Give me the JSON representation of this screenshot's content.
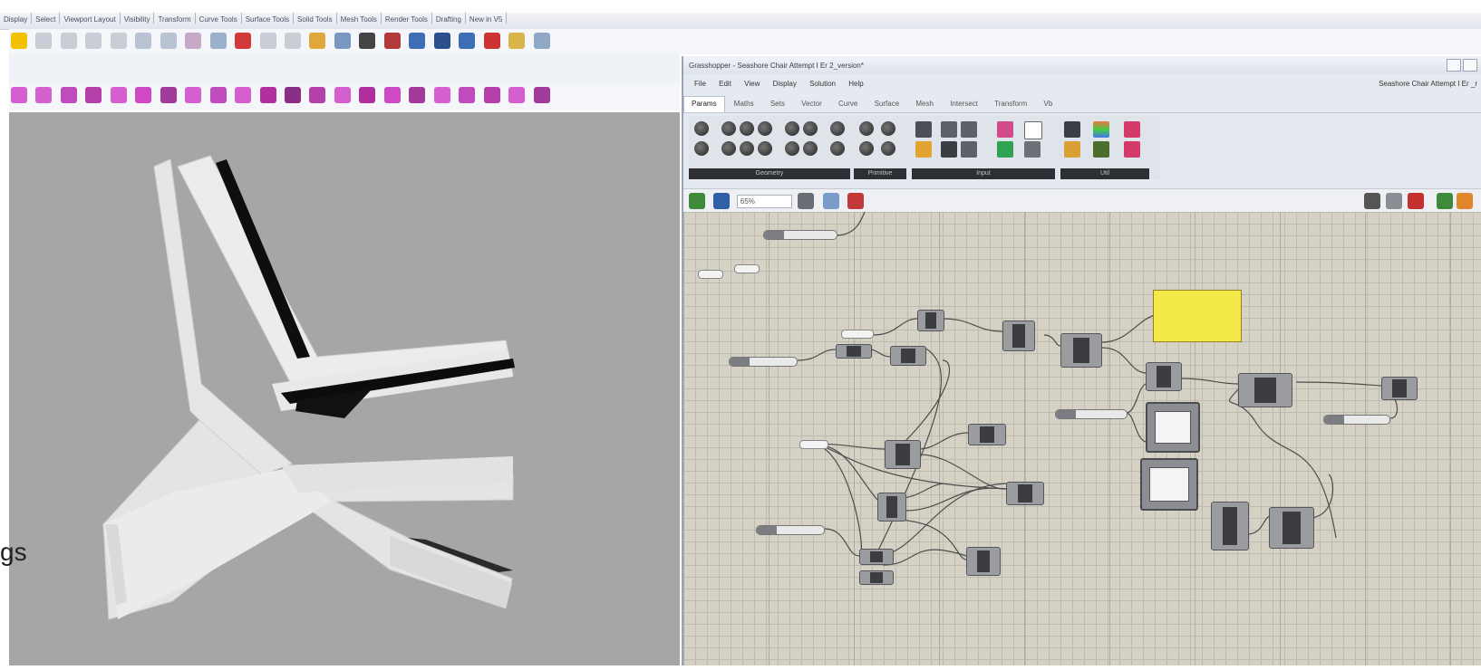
{
  "rhino": {
    "tabs": [
      "Display",
      "Select",
      "Viewport Layout",
      "Visibility",
      "Transform",
      "Curve Tools",
      "Surface Tools",
      "Solid Tools",
      "Mesh Tools",
      "Render Tools",
      "Drafting",
      "New in V5"
    ],
    "edge_label": "gs"
  },
  "grasshopper": {
    "title": "Grasshopper - Seashore Chair Attempt I Er 2_version*",
    "menu": [
      "File",
      "Edit",
      "View",
      "Display",
      "Solution",
      "Help"
    ],
    "doc_name": "Seashore Chair Attempt I Er _r",
    "component_tabs": [
      "Params",
      "Maths",
      "Sets",
      "Vector",
      "Curve",
      "Surface",
      "Mesh",
      "Intersect",
      "Transform",
      "Vb"
    ],
    "active_tab": "Params",
    "ribbon_groups": [
      "Geometry",
      "Primitive",
      "Input",
      "Util"
    ],
    "zoom": "65%"
  },
  "colors": {
    "viewport_bg": "#a6a6a6",
    "canvas_bg": "#d5d2c5",
    "panel_yellow": "#f5e94a",
    "node_grey": "#9a9ca0"
  }
}
